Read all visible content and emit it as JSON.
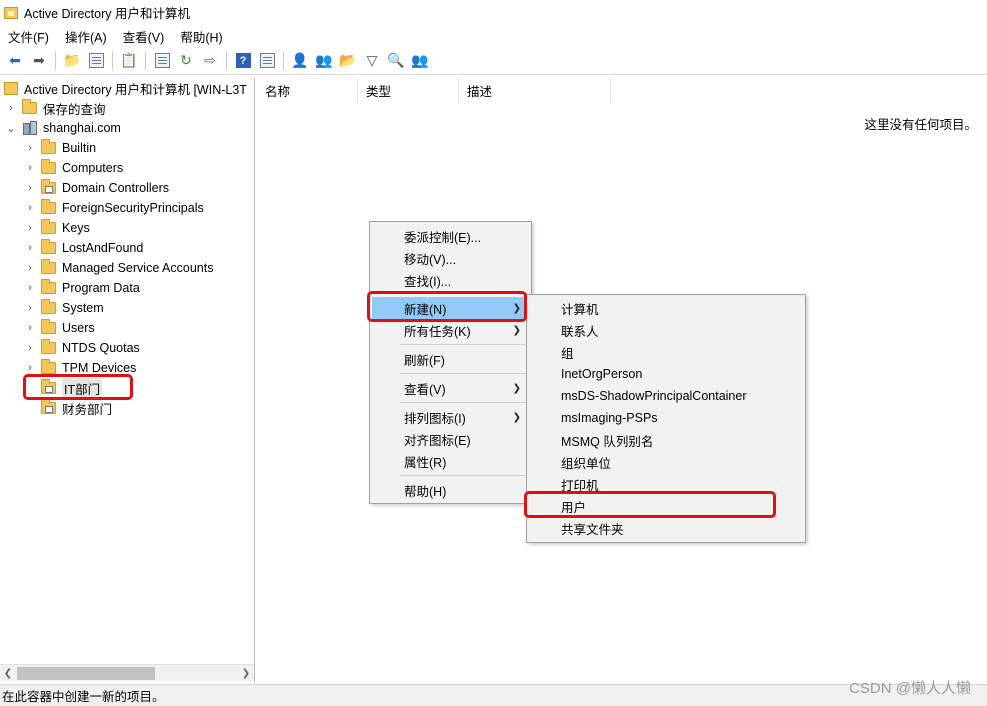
{
  "window": {
    "title": "Active Directory 用户和计算机"
  },
  "menubar": [
    "文件(F)",
    "操作(A)",
    "查看(V)",
    "帮助(H)"
  ],
  "tree": {
    "root_label": "Active Directory 用户和计算机 [WIN-L3T",
    "saved_queries": "保存的查询",
    "domain": "shanghai.com",
    "containers": [
      "Builtin",
      "Computers",
      "Domain Controllers",
      "ForeignSecurityPrincipals",
      "Keys",
      "LostAndFound",
      "Managed Service Accounts",
      "Program Data",
      "System",
      "Users",
      "NTDS Quotas",
      "TPM Devices",
      "IT部门",
      "财务部门"
    ]
  },
  "list": {
    "columns": [
      "名称",
      "类型",
      "描述"
    ],
    "empty_message": "这里没有任何项目。"
  },
  "context_menu": {
    "items": [
      "委派控制(E)...",
      "移动(V)...",
      "查找(I)...",
      "新建(N)",
      "所有任务(K)",
      "刷新(F)",
      "查看(V)",
      "排列图标(I)",
      "对齐图标(E)",
      "属性(R)",
      "帮助(H)"
    ]
  },
  "submenu_new": {
    "items": [
      "计算机",
      "联系人",
      "组",
      "InetOrgPerson",
      "msDS-ShadowPrincipalContainer",
      "msImaging-PSPs",
      "MSMQ 队列别名",
      "组织单位",
      "打印机",
      "用户",
      "共享文件夹"
    ]
  },
  "status_text": "在此容器中创建一新的项目。",
  "watermark": "CSDN @懒人人懒",
  "colors": {
    "highlight": "#91c9f7",
    "annotation_red": "#e01010",
    "folder": "#f4c75a"
  }
}
